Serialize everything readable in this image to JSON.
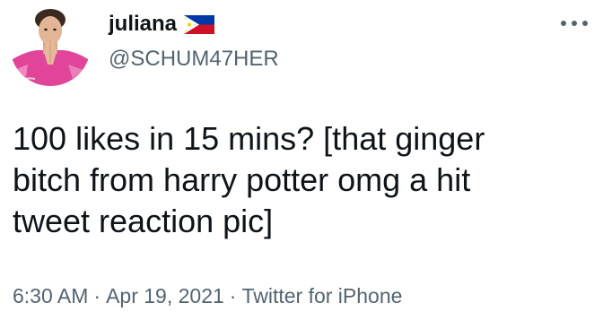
{
  "author": {
    "display_name": "juliana",
    "handle": "@SCHUM47HER",
    "flag_icon": "philippines-flag-icon",
    "avatar_icon": "profile-avatar"
  },
  "more_icon": "more-horizontal-icon",
  "tweet": {
    "text": "100 likes in 15 mins? [that ginger\nbitch from harry potter omg a hit\ntweet reaction pic]"
  },
  "meta": {
    "time": "6:30 AM",
    "separator": "·",
    "date": "Apr 19, 2021",
    "source": "Twitter for iPhone"
  },
  "colors": {
    "text_primary": "#0f1419",
    "text_secondary": "#536471",
    "avatar_shirt": "#e0459a"
  }
}
